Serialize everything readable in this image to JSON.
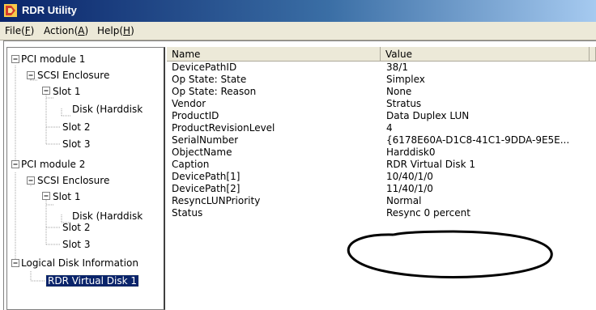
{
  "window": {
    "title": "RDR Utility",
    "icon": "rdr-app-icon"
  },
  "menu": [
    {
      "pre": "File(",
      "key": "F",
      "post": ")"
    },
    {
      "pre": "Action(",
      "key": "A",
      "post": ")"
    },
    {
      "pre": "Help(",
      "key": "H",
      "post": ")"
    }
  ],
  "tree": [
    {
      "label": "PCI module 1",
      "expander": "−"
    },
    {
      "label": "SCSI Enclosure",
      "expander": "−"
    },
    {
      "label": "Slot 1",
      "expander": "−"
    },
    {
      "label": "Disk (Harddisk",
      "expander": ""
    },
    {
      "label": "Slot 2",
      "expander": ""
    },
    {
      "label": "Slot 3",
      "expander": ""
    },
    {
      "label": "PCI module 2",
      "expander": "−"
    },
    {
      "label": "SCSI Enclosure",
      "expander": "−"
    },
    {
      "label": "Slot 1",
      "expander": "−"
    },
    {
      "label": "Disk (Harddisk",
      "expander": ""
    },
    {
      "label": "Slot 2",
      "expander": ""
    },
    {
      "label": "Slot 3",
      "expander": ""
    },
    {
      "label": "Logical Disk Information",
      "expander": "−"
    },
    {
      "label": "RDR Virtual Disk 1",
      "expander": "",
      "selected": true
    }
  ],
  "table": {
    "headers": {
      "name": "Name",
      "value": "Value"
    },
    "rows": [
      {
        "name": "DevicePathID",
        "value": "38/1"
      },
      {
        "name": "Op State: State",
        "value": "Simplex"
      },
      {
        "name": "Op State: Reason",
        "value": "None"
      },
      {
        "name": "Vendor",
        "value": "Stratus"
      },
      {
        "name": "ProductID",
        "value": "Data Duplex LUN"
      },
      {
        "name": "ProductRevisionLevel",
        "value": "4"
      },
      {
        "name": "SerialNumber",
        "value": "{6178E60A-D1C8-41C1-9DDA-9E5E..."
      },
      {
        "name": "ObjectName",
        "value": "Harddisk0"
      },
      {
        "name": "Caption",
        "value": "RDR Virtual Disk 1"
      },
      {
        "name": "DevicePath[1]",
        "value": "10/40/1/0"
      },
      {
        "name": "DevicePath[2]",
        "value": "11/40/1/0"
      },
      {
        "name": "ResyncLUNPriority",
        "value": "Normal"
      },
      {
        "name": "Status",
        "value": "Resync  0 percent"
      }
    ]
  }
}
